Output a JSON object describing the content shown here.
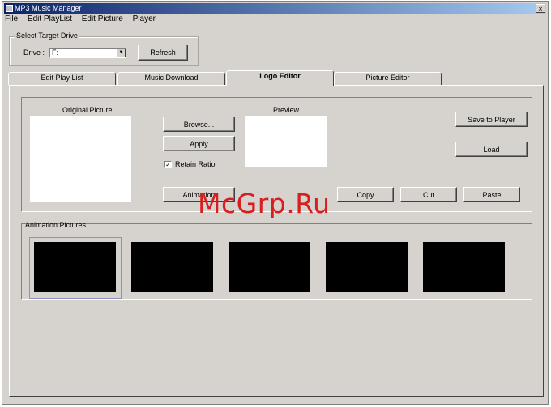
{
  "window": {
    "title": "MP3 Music Manager",
    "close_glyph": "×"
  },
  "menu": [
    "File",
    "Edit PlayList",
    "Edit Picture",
    "Player"
  ],
  "target_drive": {
    "group_label": "Select Target Drive",
    "drive_label": "Drive :",
    "drive_value": "F:",
    "refresh_label": "Refresh"
  },
  "tabs": [
    {
      "label": "Edit Play List",
      "active": false
    },
    {
      "label": "Music Download",
      "active": false
    },
    {
      "label": "Logo Editor",
      "active": true
    },
    {
      "label": "Picture Editor",
      "active": false
    }
  ],
  "logo_editor": {
    "original_label": "Original Picture",
    "preview_label": "Preview",
    "browse_label": "Browse...",
    "apply_label": "Apply",
    "retain_ratio_label": "Retain Ratio",
    "retain_ratio_checked": true,
    "check_glyph": "✓",
    "animation_label": "Animation",
    "copy_label": "Copy",
    "cut_label": "Cut",
    "paste_label": "Paste",
    "save_to_player_label": "Save to Player",
    "load_label": "Load"
  },
  "animation": {
    "group_label": "Animation Pictures",
    "frame_count": 5,
    "selected_index": 0
  },
  "watermark": "McGrp.Ru"
}
